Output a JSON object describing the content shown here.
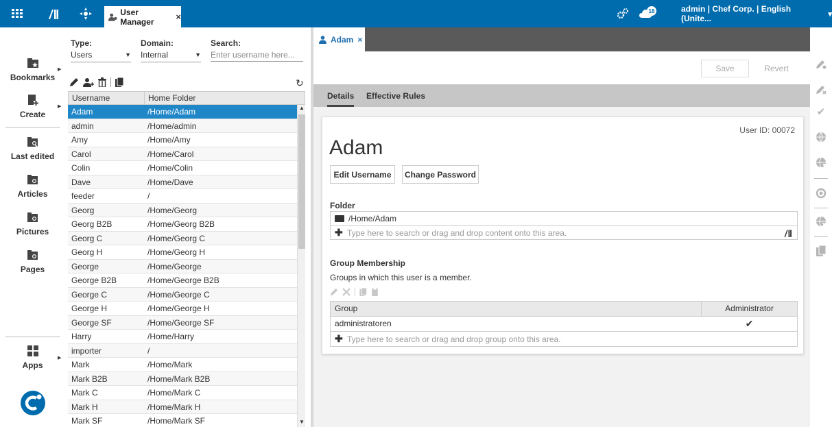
{
  "topbar": {
    "tab_label": "User Manager",
    "tab_close": "×",
    "notification_count": "18",
    "user_info": "admin | Chef Corp. | English (Unite...",
    "user_menu_caret": "▾"
  },
  "leftnav": {
    "items": [
      {
        "label": "Bookmarks",
        "icon": "bookmark-folder-icon"
      },
      {
        "label": "Create",
        "icon": "create-document-icon"
      },
      {
        "label": "Last edited",
        "icon": "folder-search-icon"
      },
      {
        "label": "Articles",
        "icon": "folder-search-icon"
      },
      {
        "label": "Pictures",
        "icon": "folder-search-icon"
      },
      {
        "label": "Pages",
        "icon": "folder-search-icon"
      },
      {
        "label": "Apps",
        "icon": "apps-grid-icon"
      }
    ]
  },
  "filters": {
    "type_label": "Type:",
    "type_value": "Users",
    "domain_label": "Domain:",
    "domain_value": "Internal",
    "search_label": "Search:",
    "search_placeholder": "Enter username here..."
  },
  "user_table": {
    "col_username": "Username",
    "col_home": "Home Folder",
    "rows": [
      {
        "username": "Adam",
        "home": "/Home/Adam",
        "selected": true
      },
      {
        "username": "admin",
        "home": "/Home/admin"
      },
      {
        "username": "Amy",
        "home": "/Home/Amy"
      },
      {
        "username": "Carol",
        "home": "/Home/Carol"
      },
      {
        "username": "Colin",
        "home": "/Home/Colin"
      },
      {
        "username": "Dave",
        "home": "/Home/Dave"
      },
      {
        "username": "feeder",
        "home": "/"
      },
      {
        "username": "Georg",
        "home": "/Home/Georg"
      },
      {
        "username": "Georg B2B",
        "home": "/Home/Georg B2B"
      },
      {
        "username": "Georg C",
        "home": "/Home/Georg C"
      },
      {
        "username": "Georg H",
        "home": "/Home/Georg H"
      },
      {
        "username": "George",
        "home": "/Home/George"
      },
      {
        "username": "George B2B",
        "home": "/Home/George B2B"
      },
      {
        "username": "George C",
        "home": "/Home/George C"
      },
      {
        "username": "George H",
        "home": "/Home/George H"
      },
      {
        "username": "George SF",
        "home": "/Home/George SF"
      },
      {
        "username": "Harry",
        "home": "/Home/Harry"
      },
      {
        "username": "importer",
        "home": "/"
      },
      {
        "username": "Mark",
        "home": "/Home/Mark"
      },
      {
        "username": "Mark B2B",
        "home": "/Home/Mark B2B"
      },
      {
        "username": "Mark C",
        "home": "/Home/Mark C"
      },
      {
        "username": "Mark H",
        "home": "/Home/Mark H"
      },
      {
        "username": "Mark SF",
        "home": "/Home/Mark SF"
      }
    ]
  },
  "doc": {
    "tab_label": "Adam",
    "tab_close": "×",
    "save_label": "Save",
    "revert_label": "Revert",
    "subtab_details": "Details",
    "subtab_rules": "Effective Rules",
    "user_id": "User ID: 00072",
    "user_name": "Adam",
    "edit_username_label": "Edit Username",
    "change_password_label": "Change Password",
    "folder_title": "Folder",
    "folder_value": "/Home/Adam",
    "folder_drop_placeholder": "Type here to search or drag and drop content onto this area.",
    "group_title": "Group Membership",
    "group_desc": "Groups in which this user is a member.",
    "group_col_group": "Group",
    "group_col_admin": "Administrator",
    "groups": [
      {
        "name": "administratoren",
        "admin": "✔"
      }
    ],
    "group_drop_placeholder": "Type here to search or drag and drop group onto this area."
  },
  "colors": {
    "topbar": "#006cae",
    "selection": "#1f86c8",
    "tab_text": "#1f6fb0"
  }
}
